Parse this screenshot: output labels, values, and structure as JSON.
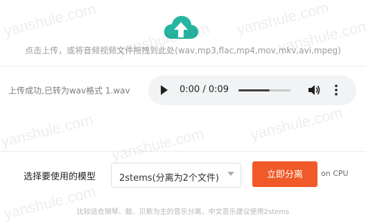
{
  "upload": {
    "icon": "cloud-upload-icon",
    "hint": "点击上传，或将音频视频文件拖拽到此处(wav,mp3,flac,mp4,mov,mkv,avi,mpeg)"
  },
  "status": {
    "message": "上传成功,已转为wav格式 1.wav"
  },
  "player": {
    "time_text": "0:00 / 0:09",
    "progress": 0.6
  },
  "controls": {
    "model_label": "选择要使用的模型",
    "model_selected": "2stems(分离为2个文件)",
    "separate_button": "立即分离",
    "device": "on CPU"
  },
  "footnote": "比较适合钢琴、鼓、贝斯为主的音乐分离，中文音乐建议使用2stems",
  "watermark": "yanshule.com",
  "colors": {
    "accent": "#f05a28",
    "icon_teal": "#26b5a0",
    "player_bg": "#f1f3f4"
  }
}
